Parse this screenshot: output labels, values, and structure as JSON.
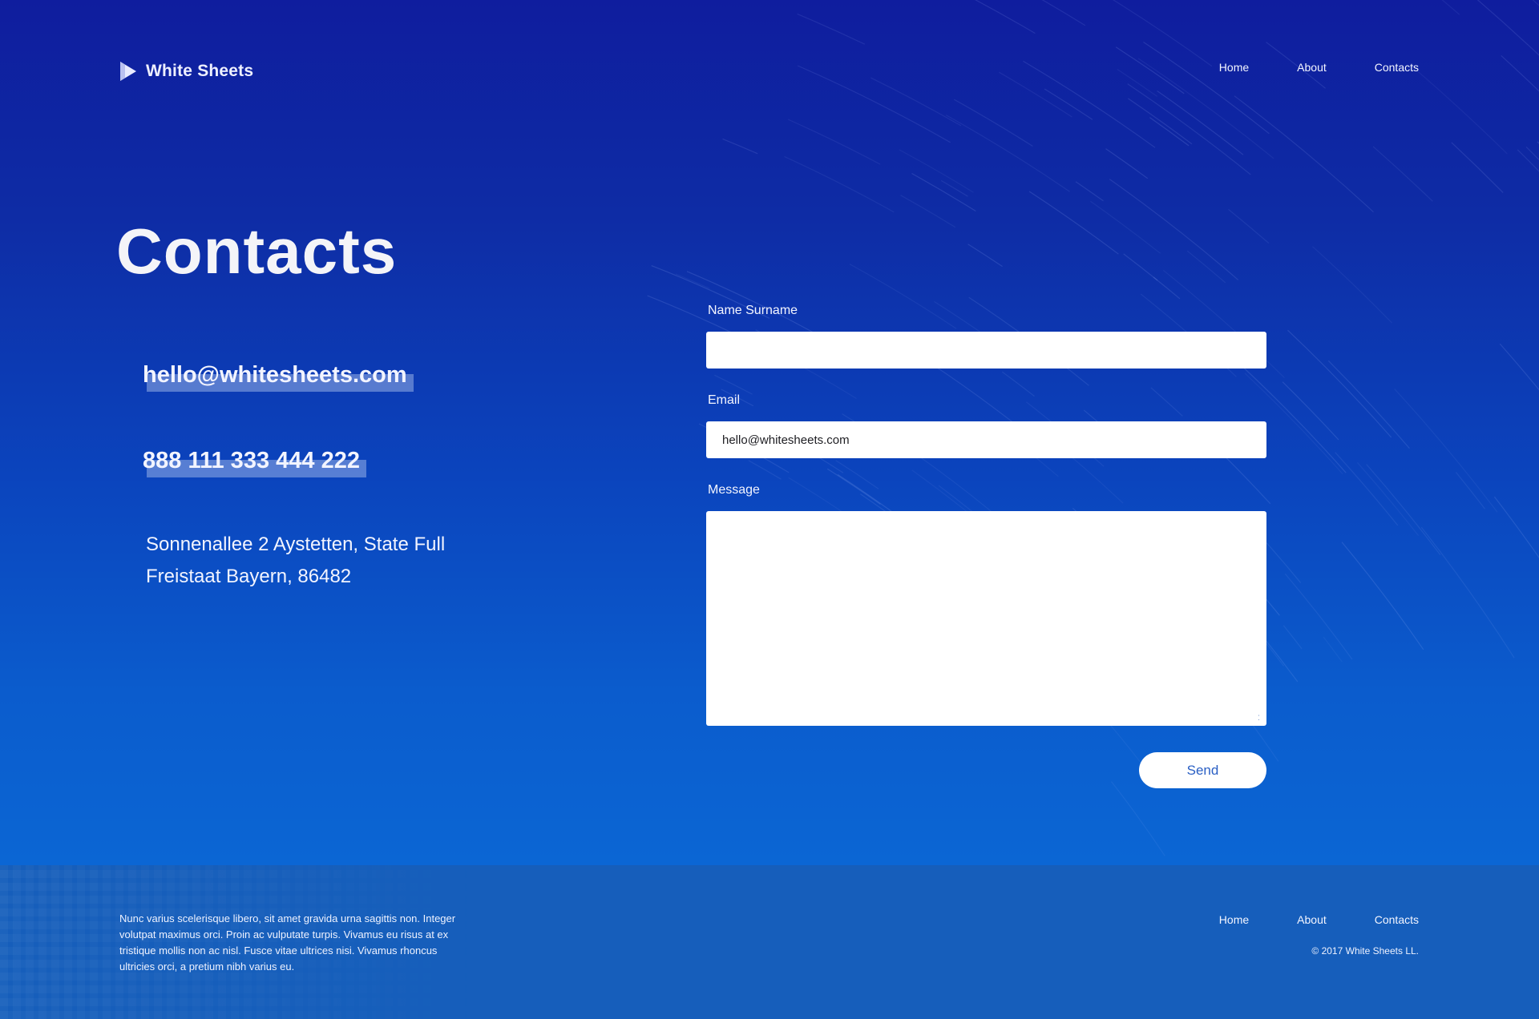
{
  "brand": {
    "name": "White Sheets",
    "logo_icon": "play-triangle-icon"
  },
  "header": {
    "nav": [
      {
        "label": "Home"
      },
      {
        "label": "About"
      },
      {
        "label": "Contacts"
      }
    ]
  },
  "main": {
    "title": "Contacts",
    "email": "hello@whitesheets.com",
    "phone": "888 111 333 444 222",
    "address_line1": "Sonnenallee 2 Aystetten, State Full",
    "address_line2": "Freistaat Bayern, 86482"
  },
  "form": {
    "name_label": "Name Surname",
    "name_value": "",
    "email_label": "Email",
    "email_value": "hello@whitesheets.com",
    "message_label": "Message",
    "message_value": "",
    "send_label": "Send"
  },
  "footer": {
    "text": "Nunc varius scelerisque libero, sit amet gravida urna sagittis non. Integer volutpat maximus orci. Proin ac vulputate turpis. Vivamus eu risus at ex tristique mollis non ac nisl. Fusce vitae ultrices nisi. Vivamus rhoncus ultricies orci, a pretium nibh varius eu.",
    "nav": [
      {
        "label": "Home"
      },
      {
        "label": "About"
      },
      {
        "label": "Contacts"
      }
    ],
    "copyright": "© 2017 White Sheets LL."
  },
  "colors": {
    "bg_top": "#0f1d9e",
    "bg_bottom": "#0b66d4",
    "footer_bg": "#0d58b9",
    "button_text": "#2a5fc4"
  }
}
